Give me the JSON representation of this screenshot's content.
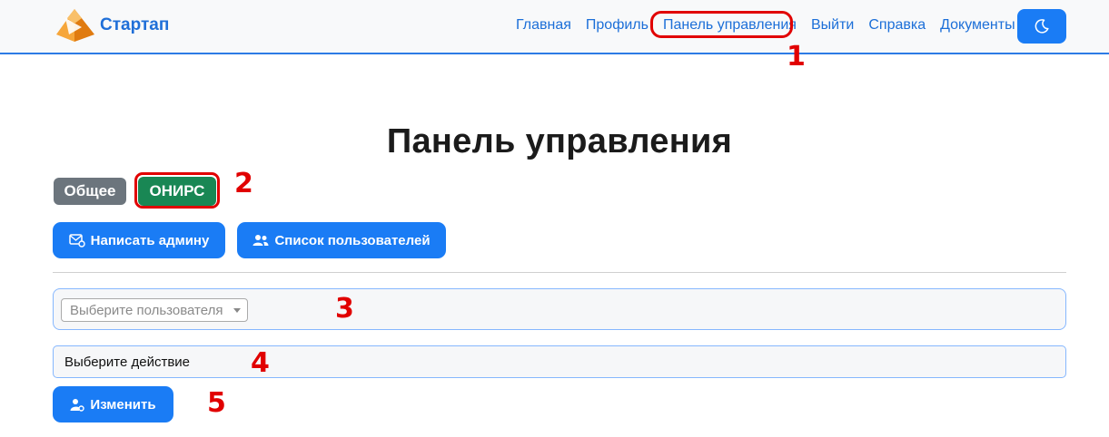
{
  "brand": {
    "name": "Стартап"
  },
  "nav": {
    "items": [
      {
        "label": "Главная"
      },
      {
        "label": "Профиль"
      },
      {
        "label": "Панель управления"
      },
      {
        "label": "Выйти"
      },
      {
        "label": "Справка"
      },
      {
        "label": "Документы"
      }
    ],
    "theme_icon": "moon-icon"
  },
  "page": {
    "title": "Панель управления"
  },
  "tabs": {
    "general": "Общее",
    "onirs": "ОНИРС"
  },
  "actions": {
    "write_admin": "Написать админу",
    "user_list": "Список пользователей"
  },
  "form": {
    "user_select_placeholder": "Выберите пользователя",
    "action_select_value": "Выберите действие",
    "submit_label": "Изменить"
  },
  "annotations": [
    "1",
    "2",
    "3",
    "4",
    "5"
  ],
  "colors": {
    "primary": "#1a7cf5",
    "secondary": "#6c757d",
    "success": "#198754",
    "annotation": "#e10000"
  }
}
